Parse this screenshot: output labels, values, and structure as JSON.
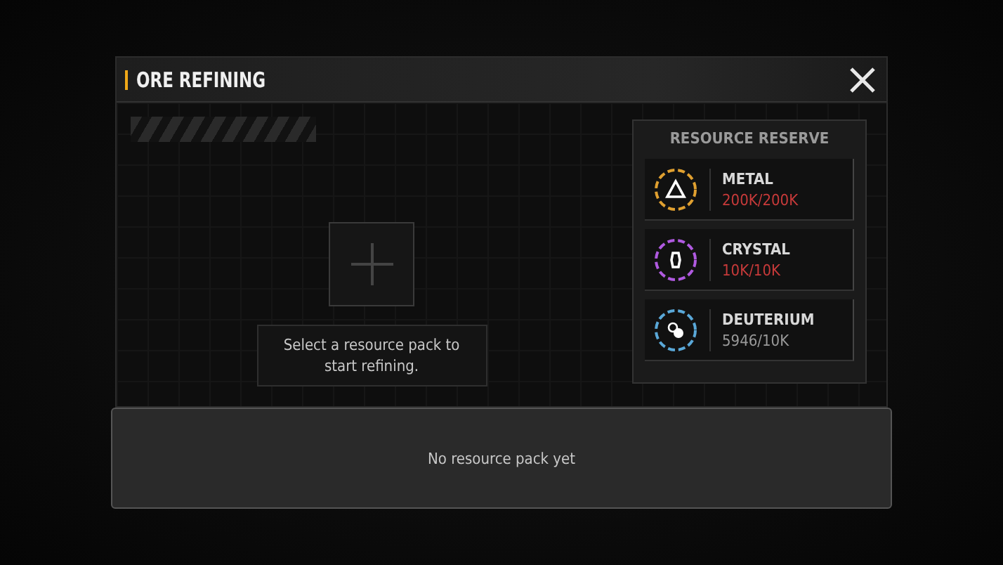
{
  "dialog": {
    "title": "ORE REFINING",
    "slot": {
      "message": "Select a resource pack to start refining."
    },
    "reserve": {
      "title": "RESOURCE RESERVE",
      "resources": [
        {
          "kind": "metal",
          "name": "METAL",
          "amount": "200K/200K",
          "full": true,
          "color": "#e0a030"
        },
        {
          "kind": "crystal",
          "name": "CRYSTAL",
          "amount": "10K/10K",
          "full": true,
          "color": "#b05ae0"
        },
        {
          "kind": "deuterium",
          "name": "DEUTERIUM",
          "amount": "5946/10K",
          "full": false,
          "color": "#5aa8d8"
        }
      ]
    },
    "footer": {
      "message": "No resource pack yet"
    }
  }
}
